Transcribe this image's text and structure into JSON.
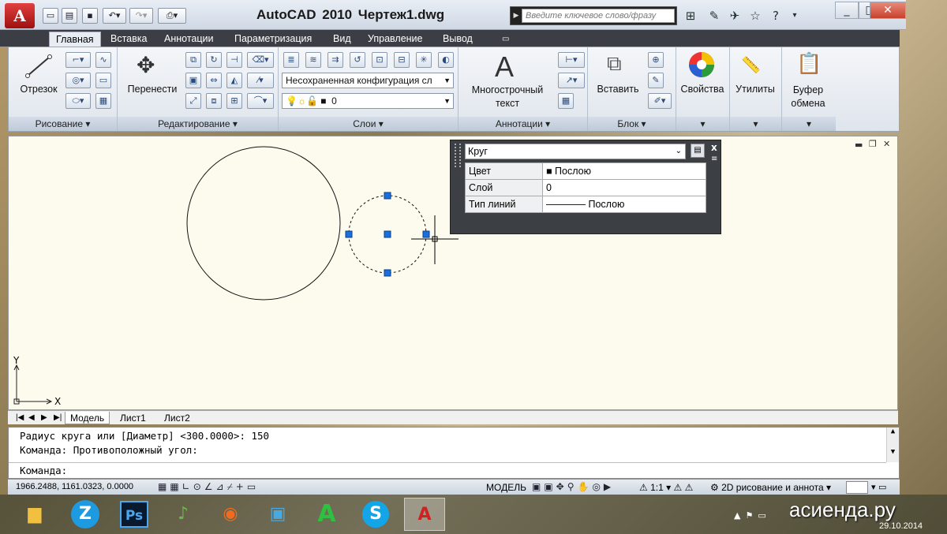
{
  "window": {
    "title": "AutoCAD 2010       Чертеж1.dwg",
    "app_logo": "A",
    "search_placeholder": "Введите ключевое слово/фразу"
  },
  "quick_access": [
    "new-icon",
    "open-icon",
    "save-icon",
    "undo-icon",
    "redo-icon",
    "print-icon"
  ],
  "tabs": [
    "Главная",
    "Вставка",
    "Аннотации",
    "Параметризация",
    "Вид",
    "Управление",
    "Вывод"
  ],
  "ribbon": {
    "draw": {
      "title": "Рисование",
      "line_label": "Отрезок"
    },
    "modify": {
      "title": "Редактирование",
      "move_label": "Перенести"
    },
    "layers": {
      "title": "Слои",
      "state_combo": "Несохраненная конфигурация сл",
      "layer_combo": "0"
    },
    "annotation": {
      "title": "Аннотации",
      "mtext_label": "Многострочный текст",
      "mtext_icon": "A"
    },
    "block": {
      "title": "Блок",
      "insert_label": "Вставить"
    },
    "properties": {
      "label": "Свойства"
    },
    "utilities": {
      "label": "Утилиты"
    },
    "clipboard": {
      "label": "Буфер обмена"
    }
  },
  "quick_props": {
    "object_type": "Круг",
    "rows": [
      {
        "name": "Цвет",
        "value": "■ Послою"
      },
      {
        "name": "Слой",
        "value": "0"
      },
      {
        "name": "Тип линий",
        "value": "———— Послою"
      }
    ]
  },
  "ucs": {
    "x": "X",
    "y": "Y"
  },
  "layout_tabs": [
    "Модель",
    "Лист1",
    "Лист2"
  ],
  "command": {
    "history": [
      "Радиус круга или [Диаметр] <300.0000>: 150",
      "Команда: Противоположный угол:"
    ],
    "prompt": "Команда:"
  },
  "status": {
    "coords": "1966.2488, 1161.0323, 0.0000",
    "space": "МОДЕЛЬ",
    "scale": "1:1",
    "workspace": "2D рисование и аннота"
  },
  "taskbar": {
    "apps": [
      "Z",
      "Ps",
      "♪",
      "◉",
      "▣",
      "A",
      "S",
      "A"
    ],
    "date": "29.10.2014",
    "watermark": "асиенда.ру"
  }
}
